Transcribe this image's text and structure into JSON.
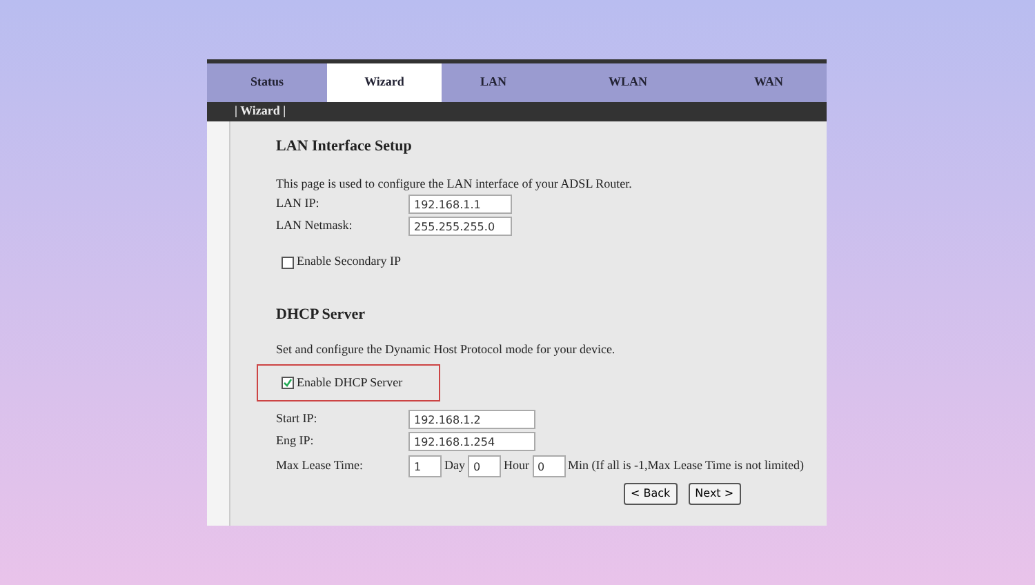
{
  "tabs": [
    {
      "label": "Status",
      "selected": false
    },
    {
      "label": "Wizard",
      "selected": true
    },
    {
      "label": "LAN",
      "selected": false
    },
    {
      "label": "WLAN",
      "selected": false
    },
    {
      "label": "WAN",
      "selected": false
    }
  ],
  "subnav": "| Wizard |",
  "lan_section": {
    "title": "LAN Interface Setup",
    "description": "This page is used to configure the LAN interface of your ADSL Router.",
    "fields": [
      {
        "label": "LAN IP:",
        "value": "192.168.1.1"
      },
      {
        "label": "LAN Netmask:",
        "value": "255.255.255.0"
      }
    ],
    "secondary_ip": {
      "label": "Enable Secondary IP",
      "checked": false
    }
  },
  "dhcp_section": {
    "title": "DHCP Server",
    "description": "Set and configure the Dynamic Host Protocol mode for your device.",
    "enable": {
      "label": "Enable DHCP Server",
      "checked": true,
      "highlighted": true
    },
    "fields": [
      {
        "label": "Start IP:",
        "value": "192.168.1.2"
      },
      {
        "label": "Eng IP:",
        "value": "192.168.1.254"
      }
    ],
    "max_lease": {
      "label": "Max Lease Time:",
      "parts": [
        {
          "value": "1",
          "unit": "Day"
        },
        {
          "value": "0",
          "unit": "Hour"
        },
        {
          "value": "0",
          "unit": "Min (If all is -1,Max Lease Time is not limited)"
        }
      ]
    }
  },
  "buttons": [
    "< Back",
    "Next >"
  ]
}
